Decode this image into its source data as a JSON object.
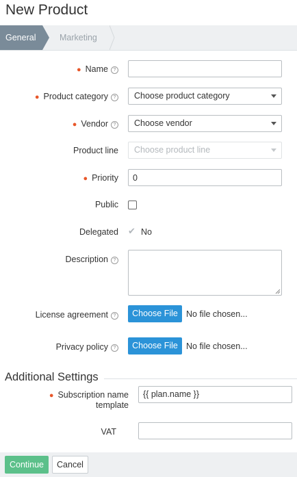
{
  "page": {
    "title": "New Product"
  },
  "wizard": {
    "steps": [
      {
        "label": "General",
        "active": true
      },
      {
        "label": "Marketing",
        "active": false
      }
    ]
  },
  "form": {
    "name": {
      "label": "Name",
      "required": true,
      "value": ""
    },
    "category": {
      "label": "Product category",
      "required": true,
      "selected": "Choose product category"
    },
    "vendor": {
      "label": "Vendor",
      "required": true,
      "selected": "Choose vendor"
    },
    "product_line": {
      "label": "Product line",
      "selected": "Choose product line",
      "disabled": true
    },
    "priority": {
      "label": "Priority",
      "required": true,
      "value": "0"
    },
    "public": {
      "label": "Public",
      "checked": false
    },
    "delegated": {
      "label": "Delegated",
      "value": "No"
    },
    "description": {
      "label": "Description",
      "value": ""
    },
    "license": {
      "label": "License agreement",
      "button": "Choose File",
      "status": "No file chosen..."
    },
    "privacy": {
      "label": "Privacy policy",
      "button": "Choose File",
      "status": "No file chosen..."
    }
  },
  "additional": {
    "title": "Additional Settings",
    "subscription": {
      "label_line1": "Subscription name",
      "label_line2": "template",
      "required": true,
      "value": "{{ plan.name }}"
    },
    "vat": {
      "label": "VAT",
      "value": ""
    }
  },
  "footer": {
    "continue": "Continue",
    "cancel": "Cancel"
  },
  "colors": {
    "required": "#e8572a",
    "primary": "#2b93d8",
    "success": "#5cc08a",
    "wizard_active": "#7a8b99"
  },
  "icons": {
    "help": "help-circle-icon",
    "caret": "caret-down-icon",
    "check": "check-icon"
  }
}
